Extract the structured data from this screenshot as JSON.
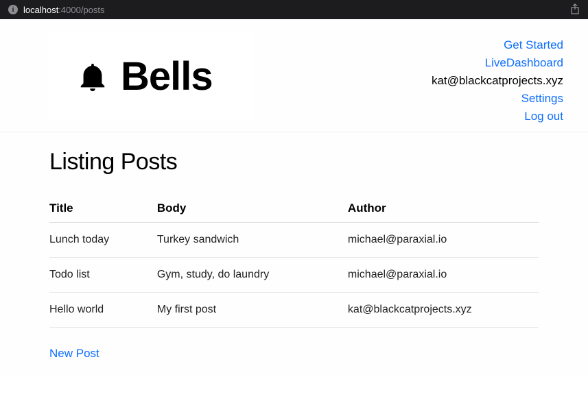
{
  "browser": {
    "url_host": "localhost",
    "url_path": ":4000/posts"
  },
  "header": {
    "logo_text": "Bells",
    "nav": {
      "get_started": "Get Started",
      "live_dashboard": "LiveDashboard",
      "user_email": "kat@blackcatprojects.xyz",
      "settings": "Settings",
      "log_out": "Log out"
    }
  },
  "main": {
    "page_title": "Listing Posts",
    "columns": {
      "title": "Title",
      "body": "Body",
      "author": "Author"
    },
    "posts": [
      {
        "title": "Lunch today",
        "body": "Turkey sandwich",
        "author": "michael@paraxial.io"
      },
      {
        "title": "Todo list",
        "body": "Gym, study, do laundry",
        "author": "michael@paraxial.io"
      },
      {
        "title": "Hello world",
        "body": "My first post",
        "author": "kat@blackcatprojects.xyz"
      }
    ],
    "new_post_label": "New Post"
  }
}
